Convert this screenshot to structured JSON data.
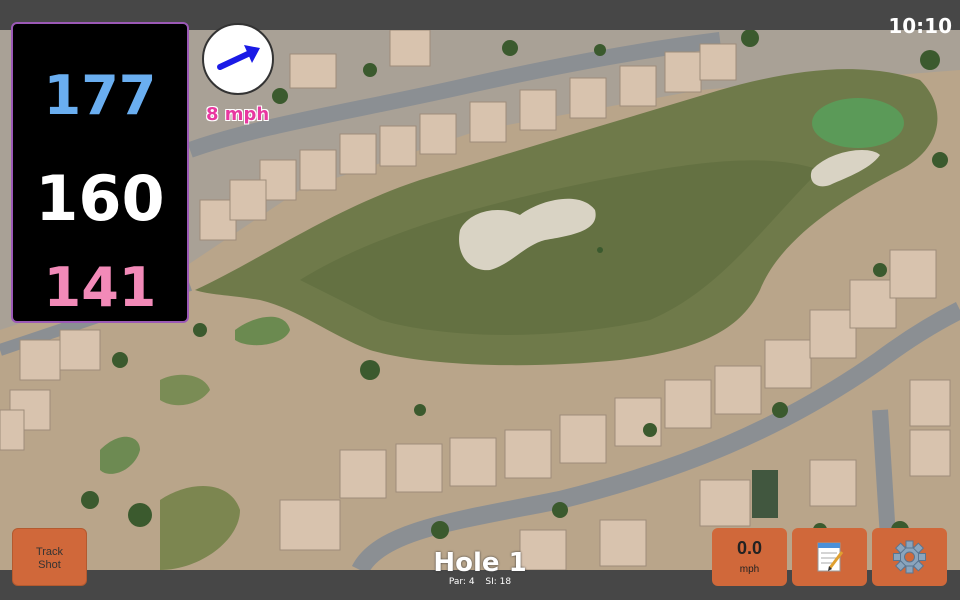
{
  "status": {
    "time": "10:10"
  },
  "distances": {
    "back": "177",
    "middle": "160",
    "front": "141"
  },
  "wind": {
    "speed_label": "8 mph",
    "icon": "wind-direction-arrow-icon"
  },
  "buttons": {
    "track_shot": {
      "line1": "Track",
      "line2": "Shot"
    },
    "speed": {
      "value": "0.0",
      "unit": "mph"
    },
    "notes_icon": "notepad-icon",
    "settings_icon": "gear-icon"
  },
  "hole": {
    "title": "Hole 1",
    "par": "Par: 4",
    "si": "SI: 18"
  },
  "colors": {
    "back": "#6aaef0",
    "middle": "#ffffff",
    "front": "#f28ab8",
    "button": "#d0683a",
    "wind_text": "#e838a0"
  }
}
